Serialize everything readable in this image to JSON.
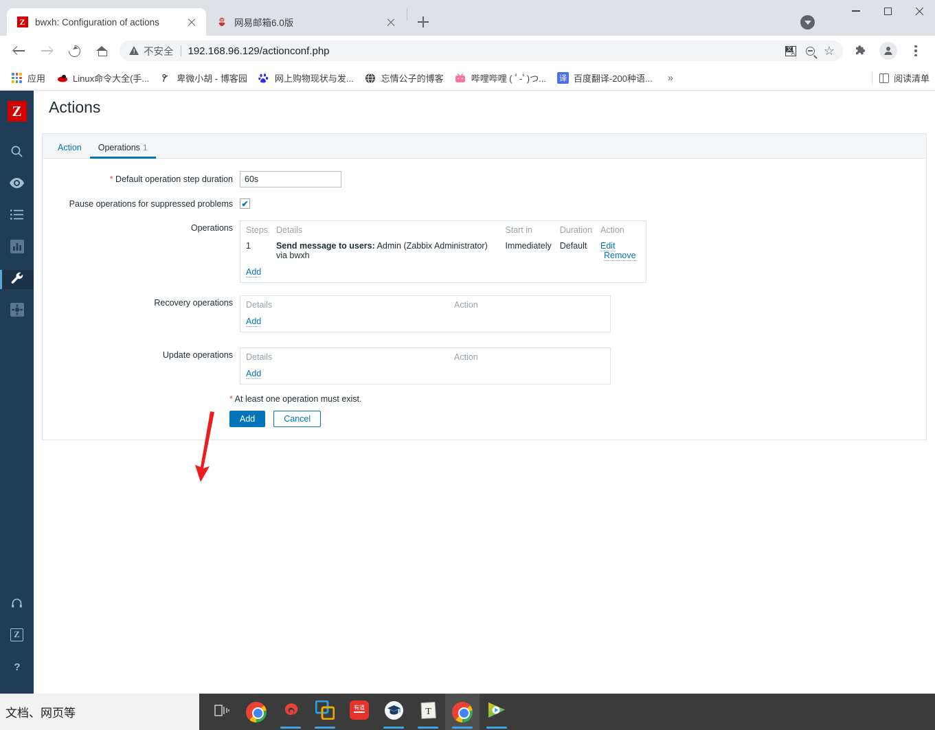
{
  "browser": {
    "tabs": [
      {
        "title": "bwxh: Configuration of actions",
        "favicon": "zabbix-favicon",
        "active": true
      },
      {
        "title": "网易邮箱6.0版",
        "favicon": "netease-mail-favicon",
        "active": false
      }
    ],
    "new_tab_label": "+",
    "window_controls": {
      "minimize": "minimize",
      "maximize": "maximize",
      "close": "close"
    },
    "toolbar": {
      "back": "back-icon",
      "forward": "forward-icon",
      "reload": "reload-icon",
      "home": "home-icon",
      "security_label": "不安全",
      "url": "192.168.96.129/actionconf.php",
      "translate": "translate-icon",
      "zoom_out": "zoom-out-icon",
      "bookmark_star": "☆",
      "extensions": "✸",
      "profile": "👤",
      "menu": "kebab-menu"
    },
    "bookmarks": [
      {
        "label": "应用",
        "icon": "apps-grid-icon"
      },
      {
        "label": "Linux命令大全(手...",
        "icon": "redhat-icon"
      },
      {
        "label": "卑微小胡 - 博客园",
        "icon": "cnblogs-icon"
      },
      {
        "label": "网上购物现状与发...",
        "icon": "baidu-icon"
      },
      {
        "label": "忘情公子的博客",
        "icon": "globe-icon"
      },
      {
        "label": "哔哩哔哩 ( ﾟ-ﾟ)つ...",
        "icon": "bilibili-icon"
      },
      {
        "label": "百度翻译-200种语...",
        "icon": "baidu-translate-icon"
      }
    ],
    "bookmarks_overflow": "»",
    "reading_list": "阅读清单"
  },
  "zabbix": {
    "logo": "Z",
    "sidebar": {
      "items": [
        {
          "name": "search",
          "icon": "search-icon",
          "selected": false
        },
        {
          "name": "monitoring",
          "icon": "eye-icon",
          "selected": false
        },
        {
          "name": "inventory",
          "icon": "list-icon",
          "selected": false
        },
        {
          "name": "reports",
          "icon": "bar-chart-icon",
          "selected": false
        },
        {
          "name": "configuration",
          "icon": "wrench-icon",
          "selected": true
        },
        {
          "name": "administration",
          "icon": "gear-icon",
          "selected": false
        }
      ],
      "bottom_items": [
        {
          "name": "support",
          "icon": "headset-icon"
        },
        {
          "name": "share",
          "icon": "zabbix-box-icon"
        },
        {
          "name": "help",
          "icon": "question-icon"
        }
      ]
    },
    "page_title": "Actions",
    "tabs": [
      {
        "label": "Action",
        "count": "",
        "active": false
      },
      {
        "label": "Operations",
        "count": "1",
        "active": true
      }
    ],
    "form": {
      "default_step_duration": {
        "label": "Default operation step duration",
        "required": "*",
        "value": "60s"
      },
      "pause_suppressed": {
        "label": "Pause operations for suppressed problems",
        "checked": true
      },
      "operations": {
        "label": "Operations",
        "headers": [
          "Steps",
          "Details",
          "Start in",
          "Duration",
          "Action"
        ],
        "rows": [
          {
            "steps": "1",
            "details_bold": "Send message to users:",
            "details_rest": "Admin (Zabbix Administrator) via bwxh",
            "start_in": "Immediately",
            "duration": "Default",
            "action_edit": "Edit",
            "action_remove": "Remove"
          }
        ],
        "add_label": "Add"
      },
      "recovery_operations": {
        "label": "Recovery operations",
        "headers": [
          "Details",
          "Action"
        ],
        "rows": [],
        "add_label": "Add"
      },
      "update_operations": {
        "label": "Update operations",
        "headers": [
          "Details",
          "Action"
        ],
        "rows": [],
        "add_label": "Add"
      },
      "footnote": "At least one operation must exist.",
      "footnote_marker": "*",
      "buttons": {
        "submit": "Add",
        "cancel": "Cancel"
      }
    },
    "colors": {
      "accent": "#0275b8",
      "sidebar": "#1f3d57",
      "required": "#d64e4e",
      "logo_red": "#d40000"
    }
  },
  "annotation": {
    "arrow": "red-arrow-pointing-to-add-button",
    "color": "#ee1c1c"
  },
  "taskbar": {
    "search_placeholder": "文档、网页等",
    "items": [
      {
        "name": "task-view",
        "icon": "task-view-icon",
        "running": false,
        "active": false
      },
      {
        "name": "google-chrome",
        "icon": "chrome-icon",
        "running": false,
        "active": false
      },
      {
        "name": "navicat",
        "icon": "navicat-icon",
        "running": true,
        "active": false
      },
      {
        "name": "vmware-workstation",
        "icon": "vmware-icon",
        "running": true,
        "active": false
      },
      {
        "name": "youdao-dictionary",
        "icon": "youdao-icon",
        "running": false,
        "active": false
      },
      {
        "name": "xuexitong",
        "icon": "graduation-cap-icon",
        "running": true,
        "active": false
      },
      {
        "name": "typora",
        "icon": "typora-icon",
        "running": true,
        "active": false
      },
      {
        "name": "chrome-window",
        "icon": "chrome-icon",
        "running": true,
        "active": true
      },
      {
        "name": "potplayer",
        "icon": "potplayer-icon",
        "running": true,
        "active": false
      }
    ]
  }
}
